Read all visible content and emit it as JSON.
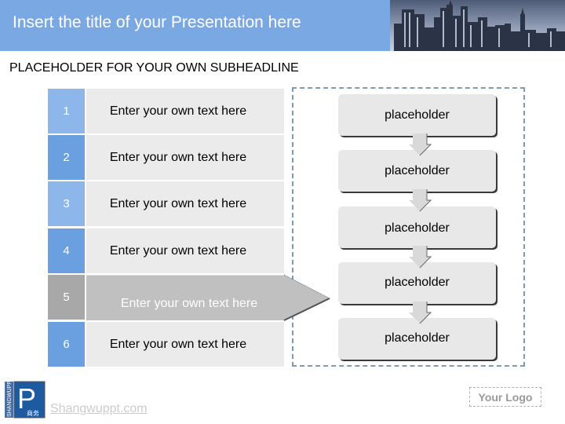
{
  "header": {
    "title": "Insert the title of your Presentation here",
    "image": "city-skyline-image",
    "band_color": "#7aa8e2"
  },
  "subheadline": "PLACEHOLDER FOR YOUR OWN SUBHEADLINE",
  "rows": [
    {
      "number": "1",
      "text": "Enter your own text here"
    },
    {
      "number": "2",
      "text": "Enter your own text here"
    },
    {
      "number": "3",
      "text": "Enter your own text here"
    },
    {
      "number": "4",
      "text": "Enter your own text here"
    },
    {
      "number": "5",
      "text": "Enter your own text here",
      "highlighted": true
    },
    {
      "number": "6",
      "text": "Enter your own text here"
    }
  ],
  "flow": {
    "boxes": [
      {
        "label": "placeholder"
      },
      {
        "label": "placeholder"
      },
      {
        "label": "placeholder"
      },
      {
        "label": "placeholder"
      },
      {
        "label": "placeholder"
      }
    ],
    "arrow_icon": "arrow-down-icon"
  },
  "footer": {
    "logo_icon": "shangwuppt-logo-icon",
    "logo_side_text": "SHANGWUPPT",
    "logo_letter": "P",
    "logo_chinese": "商务",
    "link": "Shangwuppt.com",
    "your_logo": "Your Logo"
  },
  "colors": {
    "num_light": "#8db6ea",
    "num_dark": "#6a9fe0",
    "num_highlight": "#a8a8a8",
    "text_cell_bg": "#ebebeb",
    "arrow_body": "#c0c0c0",
    "dashed_border": "#7f99ad"
  }
}
